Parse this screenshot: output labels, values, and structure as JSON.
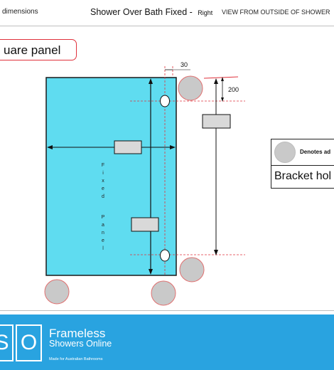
{
  "header": {
    "left_text": "dimensions",
    "title": "Shower Over Bath Fixed -",
    "title_suffix": "Right",
    "view_label": "VIEW FROM OUTSIDE OF SHOWER"
  },
  "panel_label": "uare panel",
  "panel_text": [
    "F",
    "i",
    "x",
    "e",
    "d",
    "",
    "P",
    "a",
    "n",
    "e",
    "l"
  ],
  "dimensions": {
    "top_offset": "30",
    "height_offset": "200"
  },
  "legend": {
    "denotes": "Denotes ad",
    "bracket": "Bracket hol"
  },
  "footer": {
    "logo_letters": [
      "S",
      "O"
    ],
    "brand_line1": "Frameless",
    "brand_line2": "Showers Online",
    "tagline": "Made for Australian Bathrooms"
  },
  "colors": {
    "glass": "#5fdcf0",
    "accent_red": "#e0323c",
    "footer_blue": "#29a3e0",
    "bracket_grey": "#c9c9c9"
  }
}
